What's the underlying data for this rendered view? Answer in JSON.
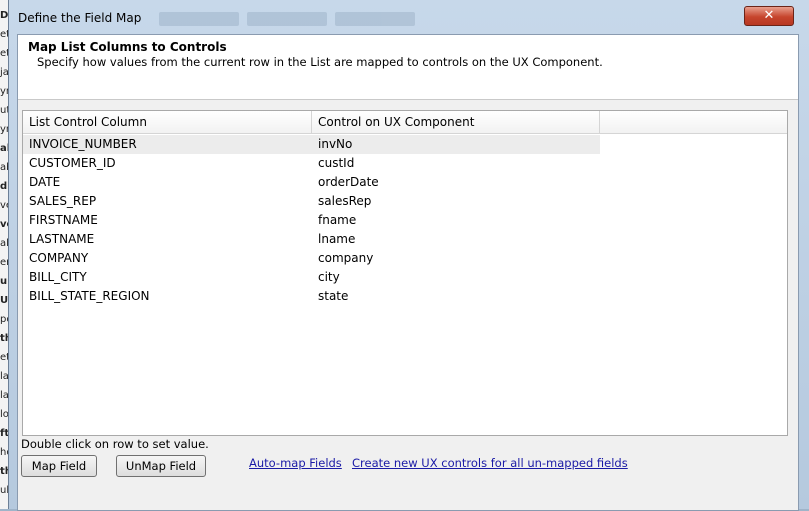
{
  "background_app": {
    "fragments": [
      {
        "text": "De",
        "bold": true
      },
      {
        "text": "et",
        "bold": false
      },
      {
        "text": "et",
        "bold": false
      },
      {
        "text": "ja",
        "bold": false
      },
      {
        "text": "yn",
        "bold": false
      },
      {
        "text": "ut",
        "bold": false
      },
      {
        "text": "yn",
        "bold": false
      },
      {
        "text": "al",
        "bold": true
      },
      {
        "text": "ab",
        "bold": false
      },
      {
        "text": "di",
        "bold": true
      },
      {
        "text": "ve",
        "bold": false
      },
      {
        "text": "ve",
        "bold": true
      },
      {
        "text": "ali",
        "bold": false
      },
      {
        "text": "er",
        "bold": false
      },
      {
        "text": "u",
        "bold": true
      },
      {
        "text": "Up",
        "bold": true
      },
      {
        "text": "po",
        "bold": false
      },
      {
        "text": "th",
        "bold": true
      },
      {
        "text": "et",
        "bold": false
      },
      {
        "text": "la",
        "bold": false
      },
      {
        "text": "la",
        "bold": false
      },
      {
        "text": "lo",
        "bold": false
      },
      {
        "text": "ft",
        "bold": true
      },
      {
        "text": "ho",
        "bold": false
      },
      {
        "text": "th",
        "bold": true
      },
      {
        "text": "ub",
        "bold": false
      }
    ]
  },
  "window": {
    "title": "Define the Field Map",
    "close_label": "✕"
  },
  "header": {
    "title": "Map List Columns to Controls",
    "description": "Specify how values from the current row in the List are mapped to controls on the UX Component."
  },
  "grid": {
    "columns": [
      "List Control Column",
      "Control on UX Component"
    ],
    "rows": [
      {
        "column": "INVOICE_NUMBER",
        "control": "invNo"
      },
      {
        "column": "CUSTOMER_ID",
        "control": "custId"
      },
      {
        "column": "DATE",
        "control": "orderDate"
      },
      {
        "column": "SALES_REP",
        "control": "salesRep"
      },
      {
        "column": "FIRSTNAME",
        "control": "fname"
      },
      {
        "column": "LASTNAME",
        "control": "lname"
      },
      {
        "column": "COMPANY",
        "control": "company"
      },
      {
        "column": "BILL_CITY",
        "control": "city"
      },
      {
        "column": "BILL_STATE_REGION",
        "control": "state"
      }
    ],
    "selected_row": 0
  },
  "footer": {
    "hint": "Double click on row to set value.",
    "map_field_label": "Map Field",
    "unmap_field_label": "UnMap Field",
    "automap_link": "Auto-map Fields",
    "create_controls_link": "Create new UX controls for all un-mapped fields"
  }
}
